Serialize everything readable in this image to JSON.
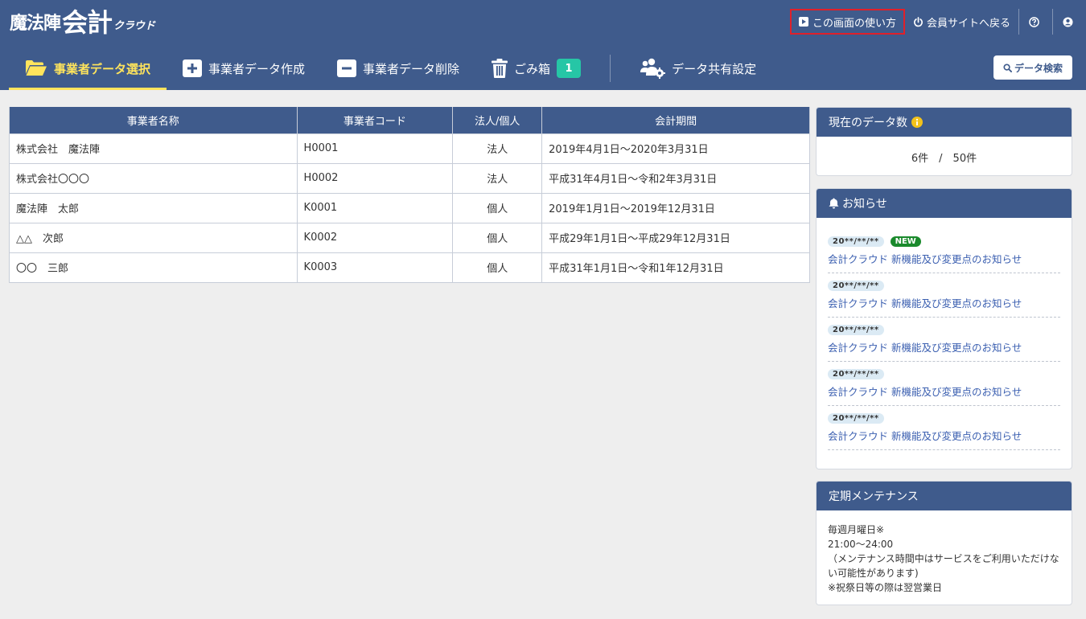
{
  "header": {
    "logo": {
      "part1": "魔法陣",
      "part2": "会計",
      "part3": "クラウド"
    },
    "topnav": {
      "howto": "この画面の使い方",
      "member_site": "会員サイトへ戻る"
    },
    "tabs": [
      {
        "label": "事業者データ選択",
        "icon": "folder-open-icon",
        "active": true
      },
      {
        "label": "事業者データ作成",
        "icon": "plus-square-icon"
      },
      {
        "label": "事業者データ削除",
        "icon": "minus-square-icon"
      },
      {
        "label": "ごみ箱",
        "icon": "trash-icon",
        "badge": "1"
      },
      {
        "label": "データ共有設定",
        "icon": "users-gear-icon"
      }
    ],
    "search_button": "データ検索"
  },
  "table": {
    "headers": [
      "事業者名称",
      "事業者コード",
      "法人/個人",
      "会計期間"
    ],
    "rows": [
      [
        "株式会社　魔法陣",
        "H0001",
        "法人",
        "2019年4月1日～2020年3月31日"
      ],
      [
        "株式会社〇〇〇",
        "H0002",
        "法人",
        "平成31年4月1日～令和2年3月31日"
      ],
      [
        "魔法陣　太郎",
        "K0001",
        "個人",
        "2019年1月1日～2019年12月31日"
      ],
      [
        "△△　次郎",
        "K0002",
        "個人",
        "平成29年1月1日～平成29年12月31日"
      ],
      [
        "〇〇　三郎",
        "K0003",
        "個人",
        "平成31年1月1日～令和1年12月31日"
      ]
    ]
  },
  "data_count": {
    "title": "現在のデータ数",
    "value": "6件　/　50件"
  },
  "news": {
    "title": "お知らせ",
    "items": [
      {
        "date": "20**/**/**",
        "new": "NEW",
        "text": "会計クラウド 新機能及び変更点のお知らせ"
      },
      {
        "date": "20**/**/**",
        "text": "会計クラウド 新機能及び変更点のお知らせ"
      },
      {
        "date": "20**/**/**",
        "text": "会計クラウド 新機能及び変更点のお知らせ"
      },
      {
        "date": "20**/**/**",
        "text": "会計クラウド 新機能及び変更点のお知らせ"
      },
      {
        "date": "20**/**/**",
        "text": "会計クラウド 新機能及び変更点のお知らせ"
      }
    ]
  },
  "maintenance": {
    "title": "定期メンテナンス",
    "lines": [
      "毎週月曜日※",
      "21:00～24:00",
      "（メンテナンス時間中はサービスをご利用いただけない可能性があります)",
      "※祝祭日等の際は翌営業日"
    ]
  },
  "colors": {
    "header": "#3f5b8c",
    "active_tab": "#ffe45c",
    "badge": "#26c6a6",
    "link": "#3b5fb0",
    "new_tag": "#1a8a2c"
  }
}
